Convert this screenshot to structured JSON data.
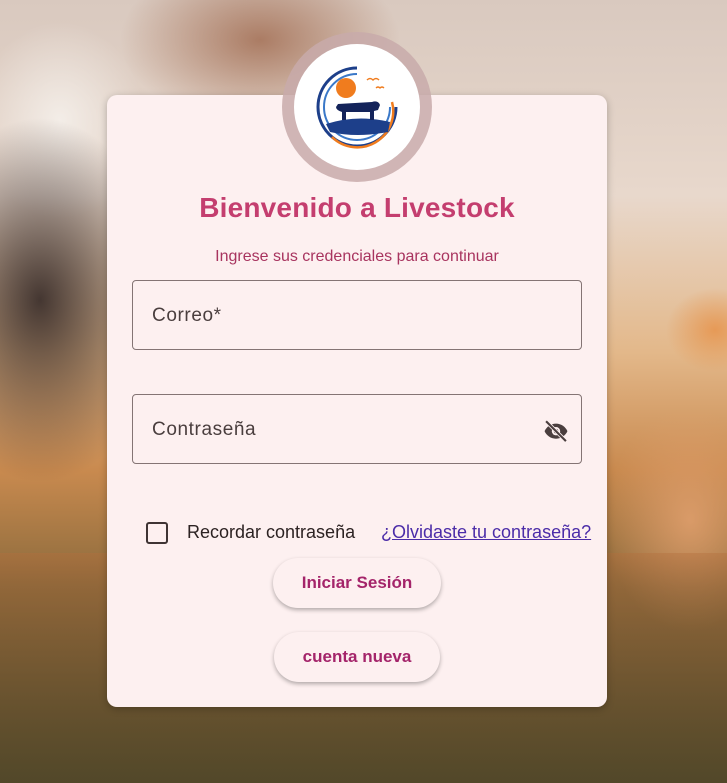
{
  "login": {
    "title": "Bienvenido a Livestock",
    "subtitle": "Ingrese sus credenciales para continuar",
    "email_label": "Correo*",
    "password_label": "Contraseña",
    "remember_label": "Recordar contraseña",
    "remember_checked": false,
    "forgot_link": "¿Olvidaste tu contraseña?",
    "login_button": "Iniciar Sesión",
    "register_button": "cuenta nueva"
  },
  "icons": {
    "logo": "livestock-bull-sunset-logo",
    "password_toggle": "eye-off-icon"
  },
  "colors": {
    "title": "#c43e6f",
    "subtitle": "#a8345f",
    "card_background": "#fdf0f0",
    "button_text": "#a4246a",
    "link": "#4b2ca8",
    "logo_blue": "#1d3f8a",
    "logo_orange": "#f07c1e"
  }
}
